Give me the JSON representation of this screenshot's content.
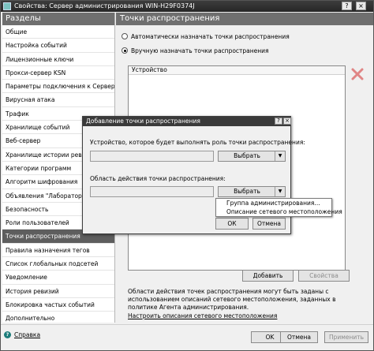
{
  "window": {
    "title": "Свойства: Сервер администрирования WIN-H29F0374J",
    "controls": [
      "?",
      "×"
    ]
  },
  "sidebar": {
    "header": "Разделы",
    "items": [
      {
        "label": "Общие"
      },
      {
        "label": "Настройка событий"
      },
      {
        "label": "Лицензионные ключи"
      },
      {
        "label": "Прокси-сервер KSN"
      },
      {
        "label": "Параметры подключения к Серверу администрирования"
      },
      {
        "label": "Вирусная атака"
      },
      {
        "label": "Трафик"
      },
      {
        "label": "Хранилище событий"
      },
      {
        "label": "Веб-сервер"
      },
      {
        "label": "Хранилище истории ревизий"
      },
      {
        "label": "Категории программ"
      },
      {
        "label": "Алгоритм шифрования"
      },
      {
        "label": "Объявления \"Лаборатории Касперского\""
      },
      {
        "label": "Безопасность"
      },
      {
        "label": "Роли пользователей"
      },
      {
        "label": "Точки распространения",
        "selected": true
      },
      {
        "label": "Правила назначения тегов"
      },
      {
        "label": "Список глобальных подсетей"
      },
      {
        "label": "Уведомление"
      },
      {
        "label": "История ревизий"
      },
      {
        "label": "Блокировка частых событий"
      },
      {
        "label": "Дополнительно"
      }
    ]
  },
  "main": {
    "header": "Точки распространения",
    "radio_auto": "Автоматически назначать точки распространения",
    "radio_manual": "Вручную назначать точки распространения",
    "table_column": "Устройство",
    "add_button": "Добавить",
    "properties_button": "Свойства",
    "note": "Области действия точек распространения могут быть заданы с использованием описаний сетевого местоположения, заданных в политике Агента администрирования.",
    "link": "Настроить описания сетевого местоположения"
  },
  "footer": {
    "help": "Справка",
    "ok": "OK",
    "cancel": "Отмена",
    "apply": "Применить"
  },
  "dialog": {
    "title": "Добавление точки распространения",
    "controls": [
      "?",
      "×"
    ],
    "device_label": "Устройство, которое будет выполнять роль точки распространения:",
    "device_value": "",
    "scope_label": "Область действия точки распространения:",
    "scope_value": "",
    "select_label": "Выбрать",
    "ok": "ОК",
    "cancel": "Отмена",
    "dropdown": [
      "Группа администрирования...",
      "Описание сетевого местоположения"
    ]
  }
}
